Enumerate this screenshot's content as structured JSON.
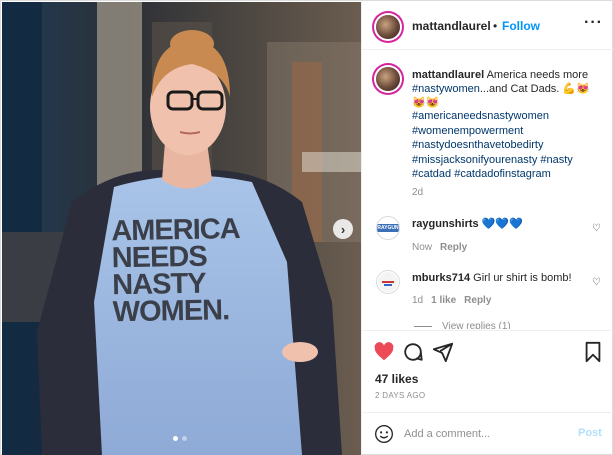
{
  "header": {
    "username": "mattandlaurel",
    "separator": "•",
    "follow_label": "Follow",
    "more_label": "···"
  },
  "caption": {
    "username": "mattandlaurel",
    "text_before": " America needs more ",
    "hashtag_inline": "#nastywomen",
    "text_after": "...and Cat Dads. 💪😻😻😻",
    "hashtags": [
      "#americaneedsnastywomen",
      "#womenempowerment",
      "#nastydoesnthavetobedirty",
      "#missjacksonifyourenasty #nasty",
      "#catdad #catdadofinstagram"
    ],
    "time": "2d"
  },
  "photo": {
    "shirt_lines": [
      "AMERICA",
      "NEEDS",
      "NASTY",
      "WOMEN."
    ],
    "next_icon": "chevron-right-icon",
    "slide_count": 2,
    "active_slide": 1
  },
  "comments": [
    {
      "username": "raygunshirts",
      "text": " 💙💙💙",
      "meta_time": "Now",
      "meta_likes": "",
      "reply_label": "Reply",
      "avatar_text": "RAYGUN"
    },
    {
      "username": "mburks714",
      "text": " Girl ur shirt is bomb!",
      "meta_time": "1d",
      "meta_likes": "1 like",
      "reply_label": "Reply",
      "avatar_text": ""
    }
  ],
  "view_replies": "View replies (1)",
  "actions": {
    "like_icon": "heart-filled-icon",
    "comment_icon": "comment-icon",
    "share_icon": "paper-plane-icon",
    "save_icon": "bookmark-icon",
    "like_color": "#ed4956"
  },
  "likes": "47 likes",
  "posted_ago": "2 DAYS AGO",
  "add_comment": {
    "placeholder": "Add a comment...",
    "post_label": "Post",
    "emoji_icon": "smiley-icon"
  }
}
